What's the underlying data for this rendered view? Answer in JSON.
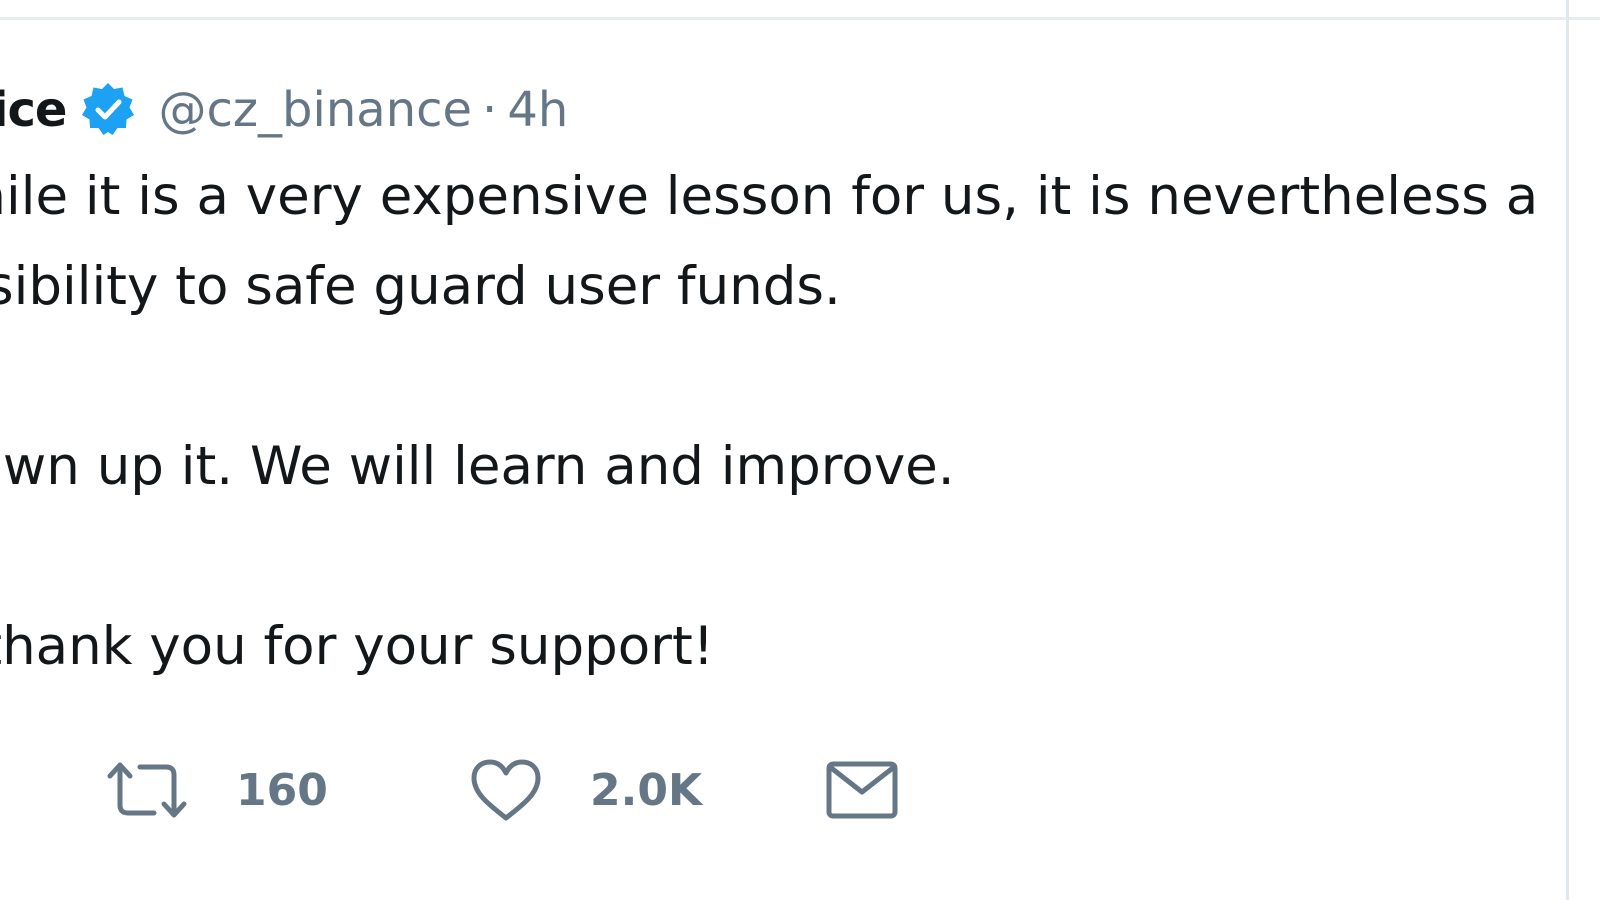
{
  "tweet": {
    "author_name": "ice",
    "verified_icon": "verified-badge-icon",
    "handle": "@cz_binance",
    "separator": "·",
    "time": "4h",
    "text_lines": [
      "While it is a very expensive lesson for us, it is nevertheless a",
      "onsibility to safe guard user funds.",
      "",
      "d own up it. We will learn and improve.",
      "",
      "s, thank you for your support!"
    ]
  },
  "actions": {
    "retweet": {
      "icon": "retweet-icon",
      "count": "160"
    },
    "like": {
      "icon": "heart-icon",
      "count": "2.0K"
    },
    "message": {
      "icon": "envelope-icon"
    }
  },
  "colors": {
    "primary_text": "#14171a",
    "secondary_text": "#657786",
    "verified_blue": "#1da1f2",
    "divider": "#e6ecf0"
  }
}
